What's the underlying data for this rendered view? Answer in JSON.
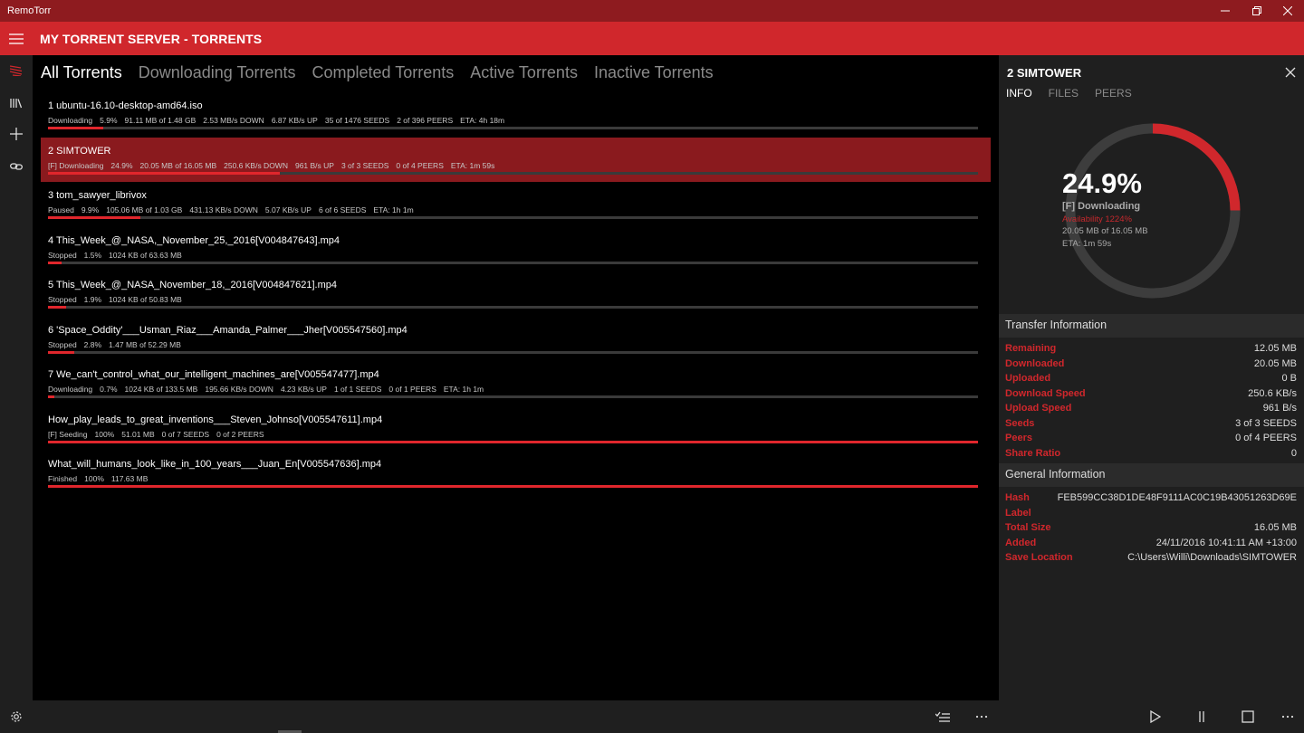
{
  "window": {
    "app_title": "RemoTorr"
  },
  "header": {
    "title": "MY TORRENT SERVER - TORRENTS"
  },
  "tabs": [
    {
      "label": "All Torrents",
      "active": true
    },
    {
      "label": "Downloading Torrents",
      "active": false
    },
    {
      "label": "Completed Torrents",
      "active": false
    },
    {
      "label": "Active Torrents",
      "active": false
    },
    {
      "label": "Inactive Torrents",
      "active": false
    }
  ],
  "torrents": [
    {
      "name": "1  ubuntu-16.10-desktop-amd64.iso",
      "stats": [
        "Downloading",
        "5.9%",
        "91.11 MB of 1.48 GB",
        "2.53 MB/s DOWN",
        "6.87 KB/s UP",
        "35 of 1476 SEEDS",
        "2 of 396 PEERS",
        "ETA: 4h 18m"
      ],
      "progress": 0.059,
      "selected": false
    },
    {
      "name": "2  SIMTOWER",
      "stats": [
        "[F] Downloading",
        "24.9%",
        "20.05 MB of 16.05 MB",
        "250.6 KB/s DOWN",
        "961 B/s UP",
        "3 of 3 SEEDS",
        "0 of 4 PEERS",
        "ETA: 1m 59s"
      ],
      "progress": 0.249,
      "selected": true
    },
    {
      "name": "3  tom_sawyer_librivox",
      "stats": [
        "Paused",
        "9.9%",
        "105.06 MB of 1.03 GB",
        "431.13 KB/s DOWN",
        "5.07 KB/s UP",
        "6 of 6 SEEDS",
        "ETA: 1h 1m"
      ],
      "progress": 0.099,
      "selected": false
    },
    {
      "name": "4  This_Week_@_NASA,_November_25,_2016[V004847643].mp4",
      "stats": [
        "Stopped",
        "1.5%",
        "1024 KB of 63.63 MB"
      ],
      "progress": 0.015,
      "selected": false
    },
    {
      "name": "5  This_Week_@_NASA_November_18,_2016[V004847621].mp4",
      "stats": [
        "Stopped",
        "1.9%",
        "1024 KB of 50.83 MB"
      ],
      "progress": 0.019,
      "selected": false
    },
    {
      "name": "6  'Space_Oddity'___Usman_Riaz___Amanda_Palmer___Jher[V005547560].mp4",
      "stats": [
        "Stopped",
        "2.8%",
        "1.47 MB of 52.29 MB"
      ],
      "progress": 0.028,
      "selected": false
    },
    {
      "name": "7  We_can't_control_what_our_intelligent_machines_are[V005547477].mp4",
      "stats": [
        "Downloading",
        "0.7%",
        "1024 KB of 133.5 MB",
        "195.66 KB/s DOWN",
        "4.23 KB/s UP",
        "1 of 1 SEEDS",
        "0 of 1 PEERS",
        "ETA: 1h 1m"
      ],
      "progress": 0.007,
      "selected": false
    },
    {
      "name": "How_play_leads_to_great_inventions___Steven_Johnso[V005547611].mp4",
      "stats": [
        "[F] Seeding",
        "100%",
        "51.01 MB",
        "0 of 7 SEEDS",
        "0 of 2 PEERS"
      ],
      "progress": 1.0,
      "selected": false
    },
    {
      "name": "What_will_humans_look_like_in_100_years___Juan_En[V005547636].mp4",
      "stats": [
        "Finished",
        "100%",
        "117.63 MB"
      ],
      "progress": 1.0,
      "selected": false
    }
  ],
  "detail": {
    "title": "2  SIMTOWER",
    "tabs": [
      {
        "label": "INFO",
        "active": true
      },
      {
        "label": "FILES",
        "active": false
      },
      {
        "label": "PEERS",
        "active": false
      }
    ],
    "ring": {
      "percent_text": "24.9%",
      "progress": 0.249,
      "status": "[F] Downloading",
      "availability": "Availability 1224%",
      "size": "20.05 MB of 16.05 MB",
      "eta": "ETA: 1m 59s"
    },
    "transfer_header": "Transfer Information",
    "transfer": [
      {
        "key": "Remaining",
        "value": "12.05 MB"
      },
      {
        "key": "Downloaded",
        "value": "20.05 MB"
      },
      {
        "key": "Uploaded",
        "value": "0 B"
      },
      {
        "key": "Download Speed",
        "value": "250.6 KB/s"
      },
      {
        "key": "Upload Speed",
        "value": "961 B/s"
      },
      {
        "key": "Seeds",
        "value": "3 of 3 SEEDS"
      },
      {
        "key": "Peers",
        "value": "0 of 4 PEERS"
      },
      {
        "key": "Share Ratio",
        "value": "0"
      }
    ],
    "general_header": "General Information",
    "general": [
      {
        "key": "Hash",
        "value": "FEB599CC38D1DE48F9111AC0C19B43051263D69E"
      },
      {
        "key": "Label",
        "value": ""
      },
      {
        "key": "Total Size",
        "value": "16.05 MB"
      },
      {
        "key": "Added",
        "value": "24/11/2016 10:41:11 AM +13:00"
      },
      {
        "key": "Save Location",
        "value": "C:\\Users\\Willi\\Downloads\\SIMTOWER"
      }
    ]
  },
  "icons": {
    "hamburger": "hamburger-icon",
    "nav": [
      "torrents-icon",
      "library-icon",
      "add-icon",
      "link-icon"
    ],
    "settings": "gear-icon",
    "bottom": [
      "select-list-icon",
      "more-icon"
    ],
    "detail_bottom": [
      "play-icon",
      "pause-icon",
      "stop-icon",
      "more-icon"
    ]
  },
  "colors": {
    "accent": "#d0272c",
    "titlebar": "#8e1b1f",
    "selected_row": "#8a1a1e"
  }
}
